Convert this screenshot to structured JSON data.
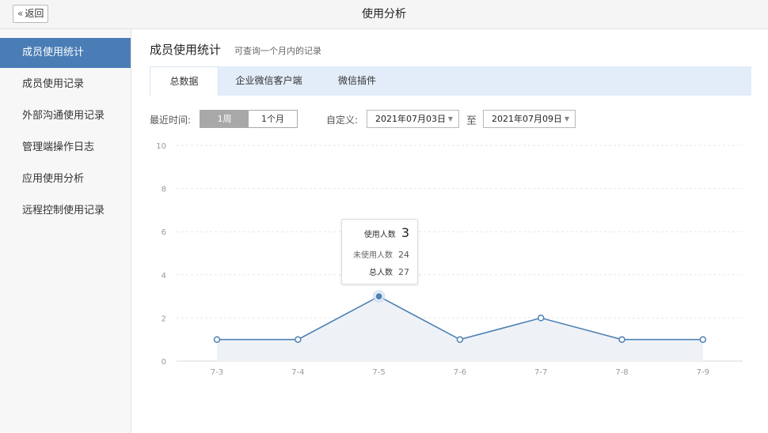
{
  "header": {
    "back_icon": "«",
    "back_label": "返回",
    "title": "使用分析"
  },
  "sidebar": {
    "items": [
      {
        "label": "成员使用统计",
        "active": true
      },
      {
        "label": "成员使用记录"
      },
      {
        "label": "外部沟通使用记录"
      },
      {
        "label": "管理端操作日志"
      },
      {
        "label": "应用使用分析"
      },
      {
        "label": "远程控制使用记录"
      }
    ]
  },
  "main": {
    "title": "成员使用统计",
    "subtitle": "可查询一个月内的记录",
    "tabs": [
      {
        "label": "总数据",
        "active": true
      },
      {
        "label": "企业微信客户端"
      },
      {
        "label": "微信插件"
      }
    ]
  },
  "filter": {
    "recent_label": "最近时间:",
    "week_label": "1周",
    "month_label": "1个月",
    "selected_range": "1周",
    "custom_label": "自定义:",
    "start_date": "2021年07月03日",
    "to_label": "至",
    "end_date": "2021年07月09日"
  },
  "tooltip": {
    "used_label": "使用人数",
    "used_value": "3",
    "unused_label": "未使用人数",
    "unused_value": "24",
    "total_label": "总人数",
    "total_value": "27"
  },
  "colors": {
    "accent": "#4a7db5",
    "line": "#4f81b3",
    "area": "#eef2f7"
  },
  "chart_data": {
    "type": "area",
    "categories": [
      "7-3",
      "7-4",
      "7-5",
      "7-6",
      "7-7",
      "7-8",
      "7-9"
    ],
    "series": [
      {
        "values": [
          1,
          1,
          3,
          1,
          2,
          1,
          1
        ]
      }
    ],
    "y_ticks": [
      0,
      2,
      4,
      6,
      8,
      10
    ],
    "ylim": [
      0,
      10
    ],
    "grid": true,
    "highlighted_category": "7-5"
  }
}
